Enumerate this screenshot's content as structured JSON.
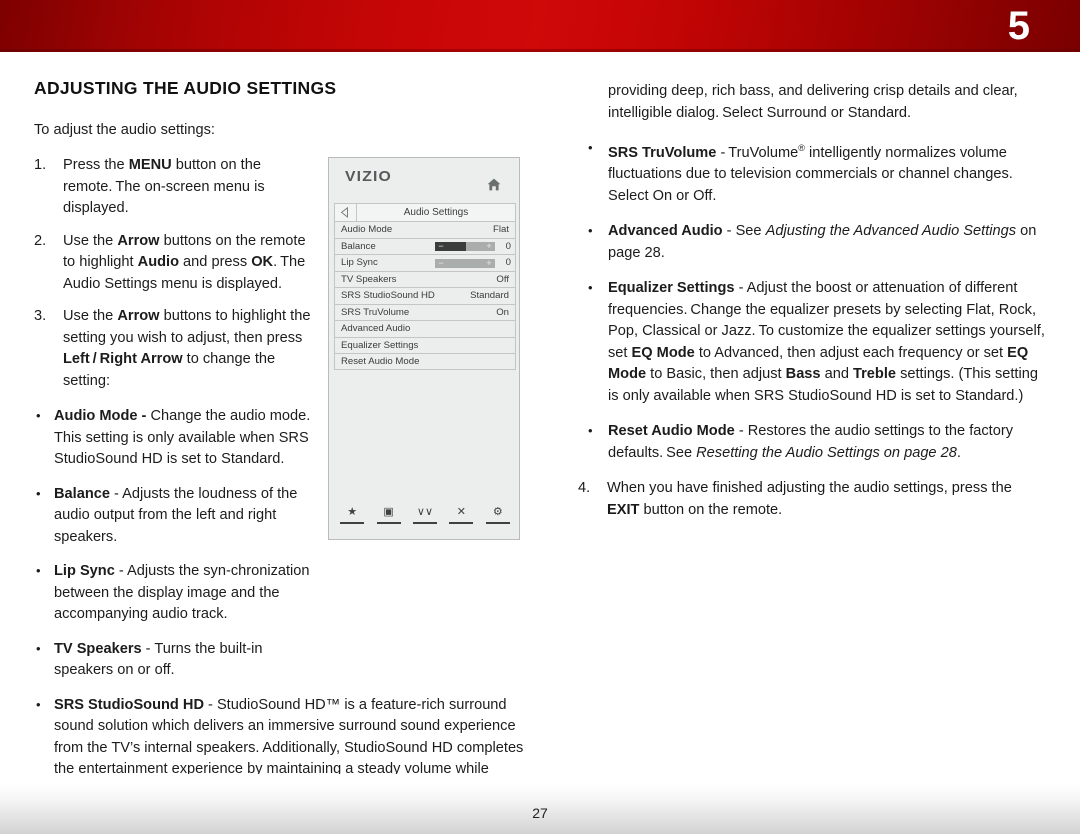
{
  "header": {
    "chapter_number": "5"
  },
  "footer": {
    "page_number": "27"
  },
  "left": {
    "title": "ADJUSTING THE AUDIO SETTINGS",
    "lead": "To adjust the audio settings:",
    "steps": [
      {
        "num": "1.",
        "html": "Press the <b>MENU</b> button on the remote.&#8201;The on-screen menu is displayed."
      },
      {
        "num": "2.",
        "html": "Use the <b>Arrow</b> buttons on the remote to highlight <b>Audio</b> and press <b>OK</b>.&#8201;The Audio Settings menu is displayed."
      },
      {
        "num": "3.",
        "html": "Use the <b>Arrow</b> buttons to highlight the setting you wish to adjust, then press <b>Left&#8201;/&#8201;Right Arrow</b> to change the setting:"
      }
    ],
    "bullets": [
      {
        "html": "<b>Audio Mode -</b> Change the audio mode.&#8201;This setting is only available when SRS StudioSound HD is set to Standard.",
        "width": "narrow"
      },
      {
        "html": "<b>Balance</b> - Adjusts the loudness of the audio output from the left and right speakers.",
        "width": "narrow"
      },
      {
        "html": "<b>Lip Sync</b> - Adjusts the syn-chronization between the display image and the accompanying audio track.",
        "width": "narrow"
      },
      {
        "html": "<b>TV Speakers</b> - Turns the built-in speakers on or off.",
        "width": "narrow"
      },
      {
        "html": "<b>SRS StudioSound HD</b> - StudioSound HD&#8482; is a feature-rich surround sound solution which delivers an immersive surround sound experience from the TV&#8217;s internal speakers.&#8201;Additionally, StudioSound HD completes the entertainment experience by maintaining a steady volume while watching programming and movies,",
        "width": "wide"
      }
    ]
  },
  "right": {
    "continuation": "providing deep, rich bass, and delivering crisp details and clear, intelligible dialog.&#8201;Select Surround or Standard.",
    "bullets": [
      {
        "html": "<b>SRS TruVolume</b> -&#8201;TruVolume<sup class=\"reg\">&#174;</sup> intelligently normalizes volume fluctuations due to television commercials or channel changes.&#8201;Select On or Off."
      },
      {
        "html": "<b>Advanced Audio</b> - See <i>Adjusting the Advanced Audio Settings</i> on page 28."
      },
      {
        "html": "<b>Equalizer Settings</b> - Adjust the boost or attenuation of different frequencies.&#8201;Change the equalizer presets by selecting Flat, Rock, Pop, Classical or Jazz.&#8201;To customize the equalizer settings yourself, set <b>EQ Mode</b> to Advanced, then adjust each frequency or set <b>EQ Mode</b> to Basic, then adjust <b>Bass</b> and <b>Treble</b> settings. (This setting is only available when SRS StudioSound HD is set to Standard.)"
      },
      {
        "html": "<b>Reset Audio Mode</b> - Restores the audio settings to the factory defaults.&#8201;See <i>Resetting the Audio Settings on page 28</i>."
      }
    ],
    "steps": [
      {
        "num": "4.",
        "html": "When you have finished adjusting the audio settings, press the <b>EXIT</b> button on the remote."
      }
    ]
  },
  "osd": {
    "brand": "VIZIO",
    "home_icon": "home-icon",
    "breadcrumb": "Audio Settings",
    "back_icon": "back-arrow-icon",
    "rows": [
      {
        "label": "Audio Mode",
        "value": "Flat",
        "type": "value"
      },
      {
        "label": "Balance",
        "value": "0",
        "type": "slider",
        "fill_pct": 52,
        "minus": "−",
        "plus": "+"
      },
      {
        "label": "Lip Sync",
        "value": "0",
        "type": "slider",
        "fill_pct": 0,
        "minus": "−",
        "plus": "+"
      },
      {
        "label": "TV Speakers",
        "value": "Off",
        "type": "value"
      },
      {
        "label": "SRS StudioSound HD",
        "value": "Standard",
        "type": "value"
      },
      {
        "label": "SRS TruVolume",
        "value": "On",
        "type": "value"
      },
      {
        "label": "Advanced Audio",
        "value": "",
        "type": "plain"
      },
      {
        "label": "Equalizer Settings",
        "value": "",
        "type": "plain"
      },
      {
        "label": "Reset Audio Mode",
        "value": "",
        "type": "plain"
      }
    ],
    "toolbar": [
      {
        "icon": "star-icon",
        "glyph": "★"
      },
      {
        "icon": "wide-screen-icon",
        "glyph": "▣"
      },
      {
        "icon": "double-chevron-down-icon",
        "glyph": "∨∨"
      },
      {
        "icon": "close-x-icon",
        "glyph": "✕"
      },
      {
        "icon": "gear-icon",
        "glyph": "⚙"
      }
    ]
  }
}
